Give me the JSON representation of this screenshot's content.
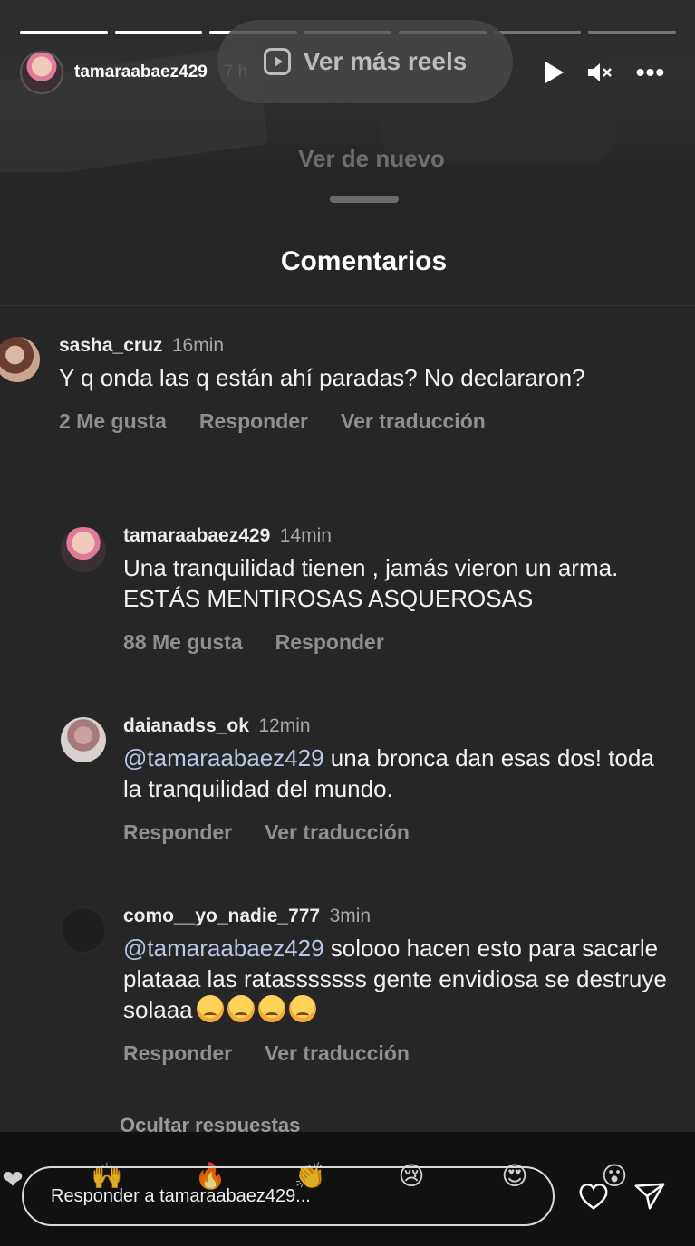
{
  "story": {
    "username": "tamaraabaez429",
    "time": "7 h",
    "reels_button": "Ver más reels",
    "replay_label": "Ver de nuevo",
    "controls": {
      "play": "play-icon",
      "mute": "mute-icon",
      "more": "more-icon"
    },
    "more_glyph": "•••",
    "mute_glyph": "🔇︎",
    "progress_segments": 7,
    "progress_completed": 5
  },
  "comments_sheet": {
    "title": "Comentarios",
    "comments": [
      {
        "user": "sasha_cruz",
        "time": "16min",
        "text": "Y q onda las q están ahí paradas? No declararon?",
        "actions": [
          "2 Me gusta",
          "Responder",
          "Ver traducción"
        ]
      },
      {
        "user": "tamaraabaez429",
        "time": "14min",
        "text": "Una tranquilidad tienen , jamás vieron un arma. ESTÁS MENTIROSAS ASQUEROSAS",
        "actions": [
          "88 Me gusta",
          "Responder"
        ]
      },
      {
        "user": "daianadss_ok",
        "time": "12min",
        "mention": "@tamaraabaez429",
        "text": " una  bronca dan esas dos! toda la tranquilidad del mundo.",
        "actions": [
          "Responder",
          "Ver traducción"
        ]
      },
      {
        "user": "como__yo_nadie_777",
        "time": "3min",
        "mention": "@tamaraabaez429",
        "text": " solooo hacen esto para sacarle plataaa las ratasssssss gente envidiosa se destruye solaaa",
        "emoji_count": 4,
        "actions": [
          "Responder",
          "Ver traducción"
        ]
      }
    ],
    "hide_replies": "Ocultar respuestas"
  },
  "bottom_bar": {
    "reply_placeholder": "Responder a tamaraabaez429...",
    "reactions": [
      "❤",
      "🙌",
      "🔥",
      "👏",
      "😢",
      "😍",
      "😮"
    ],
    "icons": [
      "heart-icon",
      "send-icon"
    ]
  },
  "colors": {
    "background": "#262626",
    "header_bg": "#2b2b2b",
    "mention": "#b9c8e6",
    "muted_text": "#8f8f8f"
  }
}
